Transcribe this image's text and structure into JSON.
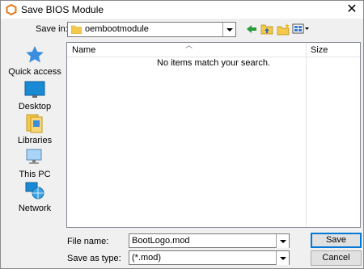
{
  "window": {
    "title": "Save BIOS Module"
  },
  "toolbar": {
    "save_in_label": "Save in:",
    "save_in_value": "oembootmodule"
  },
  "nav": {
    "items": [
      {
        "label": "Quick access",
        "icon": "quick-access-star-icon"
      },
      {
        "label": "Desktop",
        "icon": "desktop-icon"
      },
      {
        "label": "Libraries",
        "icon": "libraries-icon"
      },
      {
        "label": "This PC",
        "icon": "this-pc-icon"
      },
      {
        "label": "Network",
        "icon": "network-icon"
      }
    ]
  },
  "filelist": {
    "col_name": "Name",
    "col_size": "Size",
    "empty_message": "No items match your search."
  },
  "footer": {
    "file_name_label": "File name:",
    "file_name_value": "BootLogo.mod",
    "save_as_type_label": "Save as type:",
    "save_as_type_value": "(*.mod)",
    "save_button": "Save",
    "cancel_button": "Cancel"
  },
  "colors": {
    "accent": "#0078d7",
    "folder": "#f3c84b",
    "star": "#3b8ede"
  }
}
